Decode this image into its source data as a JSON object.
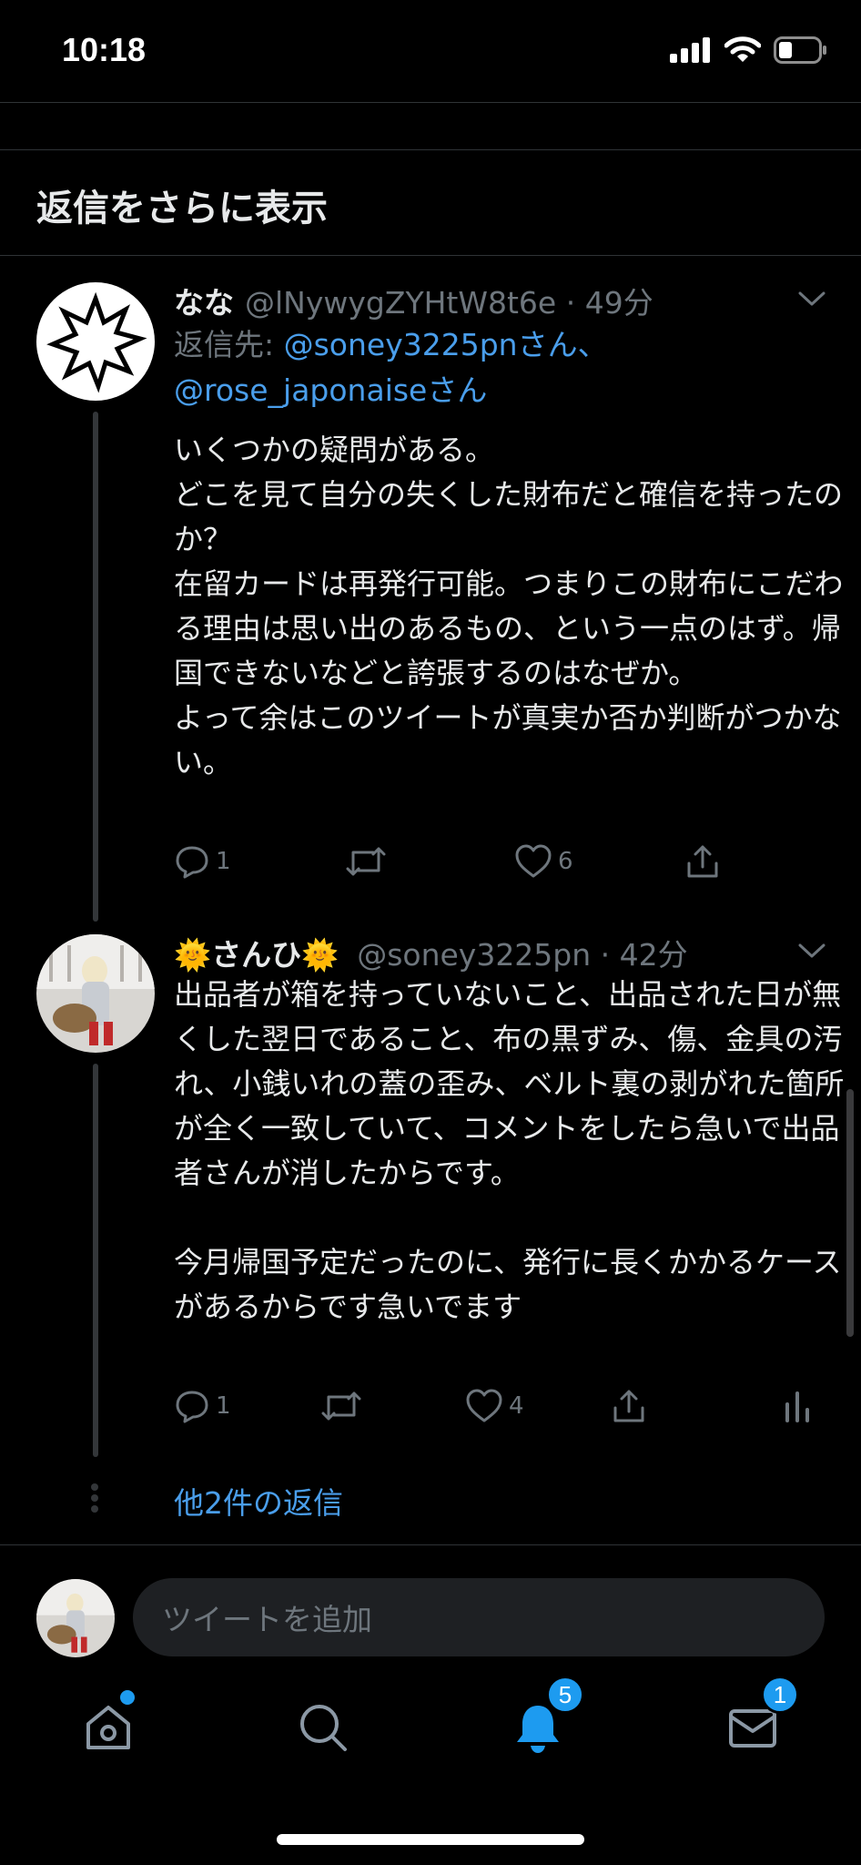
{
  "status_bar": {
    "time": "10:18"
  },
  "section": {
    "more_replies": "返信をさらに表示"
  },
  "tweet1": {
    "name": "なな",
    "handle_time": "@lNywygZYHtW8t6e · 49分",
    "reply_prefix": "返信先: ",
    "reply_to_1": "@soney3225pnさん、",
    "reply_to_2": "@rose_japonaiseさん",
    "text": "いくつかの疑問がある。\nどこを見て自分の失くした財布だと確信を持ったのか？\n在留カードは再発行可能。つまりこの財布にこだわる理由は思い出のあるもの、という一点のはず。帰国できないなどと誇張するのはなぜか。\nよって余はこのツイートが真実か否か判断がつかない。",
    "reply_count": "1",
    "like_count": "6"
  },
  "tweet2": {
    "name": "🌞さんひ🌞",
    "handle_time": "@soney3225pn · 42分",
    "text": "出品者が箱を持っていないこと、出品された日が無くした翌日であること、布の黒ずみ、傷、金具の汚れ、小銭いれの蓋の歪み、ベルト裏の剥がれた箇所が全く一致していて、コメントをしたら急いで出品者さんが消したからです。\n\n今月帰国予定だったのに、発行に長くかかるケースがあるからです急いでます",
    "reply_count": "1",
    "like_count": "4"
  },
  "thread": {
    "show_more_link": "他2件の返信"
  },
  "compose": {
    "placeholder": "ツイートを追加"
  },
  "tabbar": {
    "notifications_badge": "5",
    "messages_badge": "1"
  },
  "colors": {
    "accent": "#1d9bf0",
    "link": "#4a9eeb",
    "muted": "#6e767d",
    "background": "#000000"
  },
  "icons": [
    "home-icon",
    "search-icon",
    "bell-icon",
    "mail-icon",
    "reply-icon",
    "retweet-icon",
    "like-icon",
    "share-icon",
    "analytics-icon",
    "chevron-down-icon"
  ]
}
